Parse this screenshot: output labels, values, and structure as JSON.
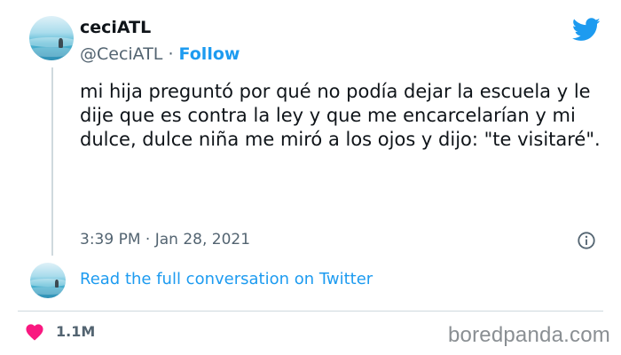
{
  "author": {
    "display_name": "ceciATL",
    "handle": "@CeciATL",
    "separator": "·",
    "follow_label": "Follow"
  },
  "tweet": {
    "text": "mi hija preguntó por qué no podía dejar la escuela y le dije que es contra la ley y que me encarcelarían y mi dulce, dulce niña me miró a los ojos y dijo: \"te visitaré\".",
    "timestamp": "3:39 PM · Jan 28, 2021"
  },
  "conversation": {
    "link_label": "Read the full conversation on Twitter"
  },
  "engagement": {
    "likes": "1.1M"
  },
  "watermark": "boredpanda.com",
  "icons": {
    "brand": "twitter-bird-icon",
    "info": "info-icon",
    "like": "heart-icon"
  },
  "colors": {
    "accent": "#1d9bf0",
    "heart": "#f91880",
    "muted_text": "#536471",
    "text": "#0f1419",
    "divider": "#cfd9de"
  }
}
